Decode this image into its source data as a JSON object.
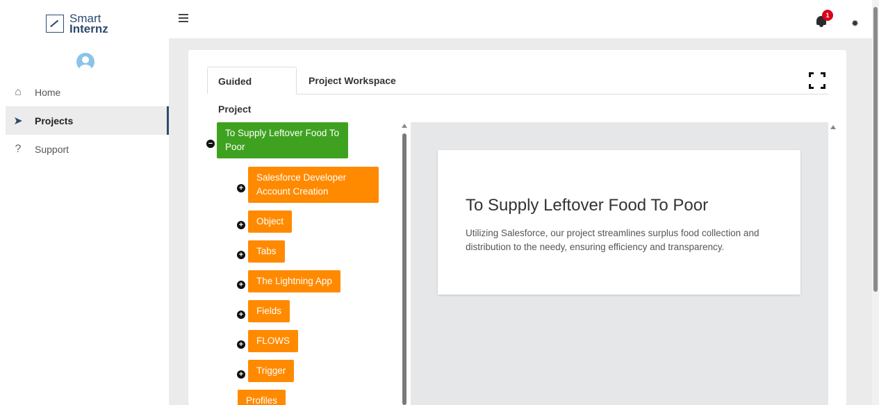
{
  "brand": {
    "line1": "Smart",
    "line2": "Internz"
  },
  "sidebar": {
    "items": [
      {
        "label": "Home",
        "icon": "home-icon",
        "glyph": "⌂"
      },
      {
        "label": "Projects",
        "icon": "paper-plane-icon",
        "glyph": "➤",
        "active": true
      },
      {
        "label": "Support",
        "icon": "question-icon",
        "glyph": "?"
      }
    ]
  },
  "header": {
    "notification_count": "1"
  },
  "tabs": [
    {
      "label": "Guided Project",
      "active": true
    },
    {
      "label": "Project Workspace",
      "active": false
    }
  ],
  "tree": {
    "root": {
      "label": "To Supply Leftover Food To Poor",
      "toggle": "−"
    },
    "children": [
      {
        "label": "Salesforce Developer Account Creation",
        "toggle": "+"
      },
      {
        "label": "Object",
        "toggle": "+"
      },
      {
        "label": "Tabs",
        "toggle": "+"
      },
      {
        "label": "The Lightning App",
        "toggle": "+"
      },
      {
        "label": "Fields",
        "toggle": "+"
      },
      {
        "label": "FLOWS",
        "toggle": "+"
      },
      {
        "label": "Trigger",
        "toggle": "+"
      },
      {
        "label": "Profiles"
      }
    ]
  },
  "detail": {
    "title": "To Supply Leftover Food To Poor",
    "description": "Utilizing Salesforce, our project streamlines surplus food collection and distribution to the needy, ensuring efficiency and transparency."
  },
  "colors": {
    "root_node": "#3ea220",
    "child_node": "#ff8a00",
    "badge": "#d9001b",
    "brand": "#2b4a6e"
  }
}
